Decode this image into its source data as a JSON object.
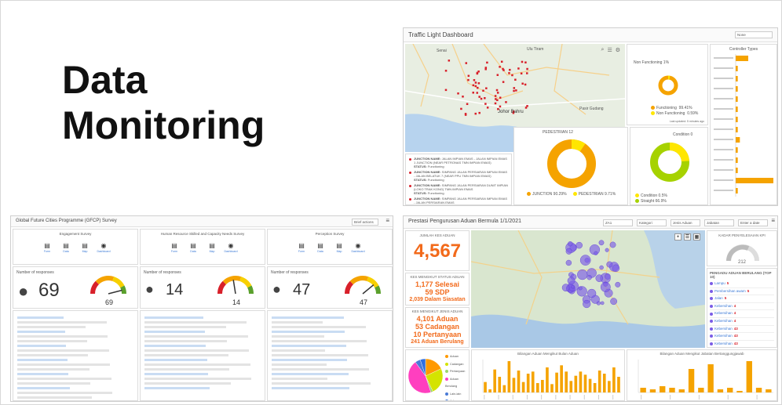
{
  "slide": {
    "title_line1": "Data",
    "title_line2": "Monitoring"
  },
  "traffic": {
    "title": "Traffic Light Dashboard",
    "select_value": "None",
    "map_labels": [
      "Johor Bahru",
      "Ulu Tiram",
      "Senai",
      "Pasir Gudang"
    ],
    "map_attribution": "Esri, HERE, Garmin, METI/NASA, USGS",
    "junctions": [
      {
        "label": "JUNCTION NAME:",
        "value": "JALAN IMPIAN EMAS - JALAN IMPIAN EMAS 1 JUNCTION (NEAR PETRONAS TMN IMPIAN EMAS)",
        "status_label": "STATUS:",
        "status": "Functioning"
      },
      {
        "label": "JUNCTION NAME:",
        "value": "SIMPANG JALAN PERSIARAN IMPIAN EMAS - JALAN BELATUK 7 (NEAR PPU TMN IMPIAN EMAS)",
        "status_label": "STATUS:",
        "status": "Functioning"
      },
      {
        "label": "JUNCTION NAME:",
        "value": "SIMPANG JALAN PERSIARAN DUNIT IMPIAN (LOKO TRAK KONG) TMN IMPIAN EMAS",
        "status_label": "STATUS:",
        "status": "Functioning"
      },
      {
        "label": "JUNCTION NAME:",
        "value": "SIMPANG JALAN PERSIARAN IMPIAN EMAS - JALAN PERSIARAN EMAS",
        "status_label": "STATUS:",
        "status": "Functioning"
      }
    ],
    "donut1": {
      "title": "Non Functioning 1%",
      "legend": [
        {
          "name": "Functioning",
          "value": "99.41%",
          "color": "#f5a300"
        },
        {
          "name": "Non Functioning",
          "value": "0.59%",
          "color": "#ffe600"
        }
      ]
    },
    "donut2": {
      "title": "PEDESTRIAN 12",
      "legend": [
        {
          "name": "JUNCTION",
          "value": "90.29%",
          "color": "#f5a300"
        },
        {
          "name": "PEDESTRIAN",
          "value": "9.71%",
          "color": "#ffe600"
        }
      ]
    },
    "donut3": {
      "title": "Condition 0",
      "legend": [
        {
          "name": "Condition",
          "value": "0.5%",
          "color": "#ffe600"
        },
        {
          "name": "Straight",
          "value": "66.9%",
          "color": "#a6d200"
        }
      ]
    },
    "bar_title": "Controller Types",
    "bar_values": [
      6,
      1,
      1,
      1,
      1,
      1,
      1,
      1,
      2,
      1,
      1,
      1,
      18,
      1
    ],
    "updated": "Last updated: 5 minutes ago"
  },
  "gfcp": {
    "title": "Global Future Cities Programme (GFCP) Survey",
    "select_value": "Brief actions",
    "sections": [
      {
        "title": "Engagement Survey",
        "responses_label": "Number of responses",
        "count": "69",
        "gauge_value": "69",
        "gauge_pct": 0.92
      },
      {
        "title": "Human Resource Skilled and Capacity Needs Survey",
        "responses_label": "Number of responses",
        "count": "14",
        "gauge_value": "14",
        "gauge_pct": 0.45
      },
      {
        "title": "Perception Survey",
        "responses_label": "Number of responses",
        "count": "47",
        "gauge_value": "47",
        "gauge_pct": 0.78
      }
    ],
    "icons": [
      "Form",
      "Data",
      "Map",
      "Dashboard"
    ]
  },
  "complaints": {
    "title": "Prestasi Pengurusan Aduan Bermula 1/1/2021",
    "filters": [
      "ZA1",
      "Kategori",
      "Jenis Aduan",
      "Jabatan",
      "Enter a date"
    ],
    "total_label": "JUMLAH KES ADUAN",
    "total": "4,567",
    "status_label": "KES MENGIKUT STATUS ADUAN",
    "status_lines": [
      "1,177 Selesai",
      "59 SDP",
      "2,039 Dalam Siasatan"
    ],
    "type_label": "KES MENGIKUT JENIS ADUAN",
    "type_lines": [
      "4,101 Aduan",
      "53 Cadangan",
      "10 Pertanyaan",
      "241 Aduan Berulang"
    ],
    "kpi_label": "KADAR PENYELESAIAN KPI",
    "kpi_value": "212",
    "repeat_title": "PENGADU ADUAN BERULANG (TOP 10)",
    "repeat_rows": [
      {
        "name": "Lampu",
        "n": "5"
      },
      {
        "name": "Pembersihan awam",
        "n": "5"
      },
      {
        "name": "Jalan",
        "n": "5"
      },
      {
        "name": "Kebersihan",
        "n": "4"
      },
      {
        "name": "Kebersihan",
        "n": "4"
      },
      {
        "name": "Kebersihan",
        "n": "4"
      },
      {
        "name": "Kebersihan",
        "n": "43"
      },
      {
        "name": "Kebersihan",
        "n": "43"
      },
      {
        "name": "Kebersihan",
        "n": "43"
      },
      {
        "name": "Kebersihan",
        "n": "43"
      }
    ],
    "pie_legend": [
      {
        "name": "Aduan",
        "color": "#ff9900"
      },
      {
        "name": "Cadangan",
        "color": "#d4e300"
      },
      {
        "name": "Pertanyaan",
        "color": "#9bd66b"
      },
      {
        "name": "Aduan Berulang",
        "color": "#ff3fbf"
      },
      {
        "name": "Lain-lain",
        "color": "#4a7bd6"
      },
      {
        "name": "Jalan",
        "color": "#2e6fe0"
      }
    ],
    "pie_values": [
      18,
      25,
      2,
      45,
      5,
      5
    ],
    "chart1_title": "Bilangan Aduan Mengikut Bulan Aduan",
    "chart1_values": [
      10,
      3,
      22,
      15,
      7,
      30,
      14,
      21,
      10,
      18,
      20,
      9,
      12,
      24,
      8,
      19,
      26,
      20,
      11,
      16,
      20,
      17,
      13,
      9,
      21,
      18,
      11,
      24,
      15
    ],
    "chart2_title": "Bilangan Aduan Mengikut Jabatan Bertanggungjawab",
    "chart2_values": [
      3,
      2,
      4,
      3,
      2,
      15,
      3,
      18,
      2,
      3,
      1,
      20,
      3,
      2
    ]
  }
}
